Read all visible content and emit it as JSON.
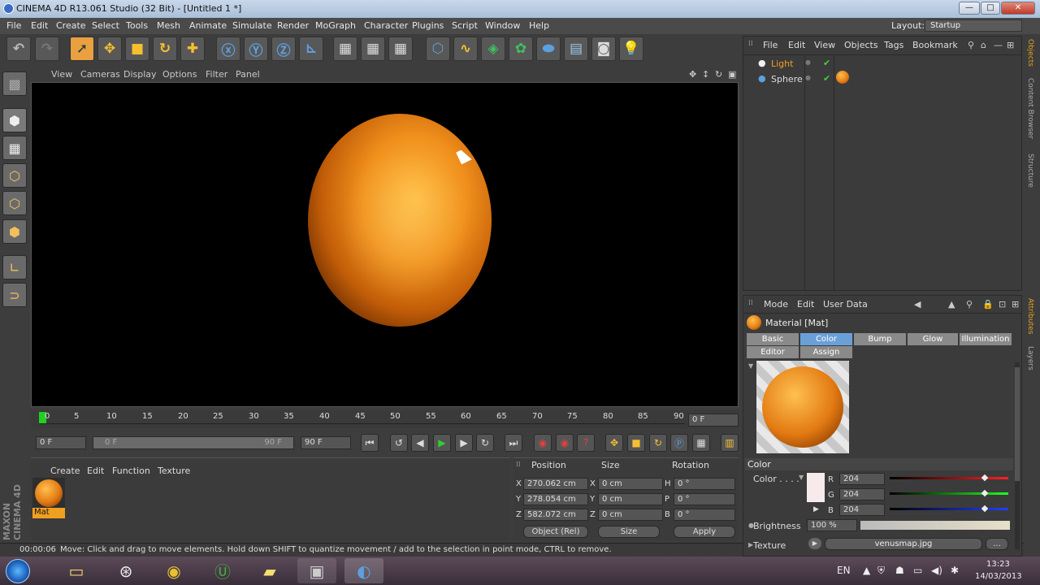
{
  "window": {
    "title": "CINEMA 4D R13.061 Studio (32 Bit) - [Untitled 1 *]",
    "min": "—",
    "max": "□",
    "close": "✕"
  },
  "menu": [
    "File",
    "Edit",
    "Create",
    "Select",
    "Tools",
    "Mesh",
    "Animate",
    "Simulate",
    "Render",
    "MoGraph",
    "Character",
    "Plugins",
    "Script",
    "Window",
    "Help"
  ],
  "layout": {
    "label": "Layout:",
    "value": "Startup"
  },
  "viewport_menu": [
    "View",
    "Cameras",
    "Display",
    "Options",
    "Filter",
    "Panel"
  ],
  "timeline": {
    "ticks": [
      "0",
      "5",
      "10",
      "15",
      "20",
      "25",
      "30",
      "35",
      "40",
      "45",
      "50",
      "55",
      "60",
      "65",
      "70",
      "75",
      "80",
      "85",
      "90"
    ],
    "current": "0 F"
  },
  "playback": {
    "start": "0 F",
    "range_start": "0 F",
    "range_end": "90 F",
    "end": "90 F"
  },
  "material_manager": {
    "menu": [
      "Create",
      "Edit",
      "Function",
      "Texture"
    ],
    "material_name": "Mat"
  },
  "coords": {
    "headers": {
      "position": "Position",
      "size": "Size",
      "rotation": "Rotation"
    },
    "rows": [
      {
        "axis": "X",
        "pos": "270.062 cm",
        "size_axis": "X",
        "size": "0 cm",
        "rot_axis": "H",
        "rot": "0 °"
      },
      {
        "axis": "Y",
        "pos": "278.054 cm",
        "size_axis": "Y",
        "size": "0 cm",
        "rot_axis": "P",
        "rot": "0 °"
      },
      {
        "axis": "Z",
        "pos": "582.072 cm",
        "size_axis": "Z",
        "size": "0 cm",
        "rot_axis": "B",
        "rot": "0 °"
      }
    ],
    "mode": "Object (Rel)",
    "size_mode": "Size",
    "apply": "Apply"
  },
  "status": {
    "time": "00:00:06",
    "message": "Move: Click and drag to move elements. Hold down SHIFT to quantize movement / add to the selection in point mode, CTRL to remove."
  },
  "objects_panel": {
    "menu": [
      "File",
      "Edit",
      "View",
      "Objects",
      "Tags",
      "Bookmark"
    ],
    "objects": [
      "Light",
      "Sphere"
    ]
  },
  "attributes": {
    "menu": [
      "Mode",
      "Edit",
      "User Data"
    ],
    "title": "Material [Mat]",
    "tabs": [
      "Basic",
      "Color",
      "Bump",
      "Glow",
      "Illumination"
    ],
    "tabs2": [
      "Editor",
      "Assign"
    ],
    "section": "Color",
    "color_label": "Color . . . .",
    "r_label": "R",
    "g_label": "G",
    "b_label": "B",
    "r": "204",
    "g": "204",
    "b": "204",
    "brightness_label": "Brightness",
    "brightness": "100 %",
    "texture_label": "Texture",
    "texture": "venusmap.jpg",
    "texture_more": "...",
    "rgb_fraction": 0.8
  },
  "side_tabs": [
    "Objects",
    "Content Browser",
    "Structure",
    "Attributes",
    "Layers"
  ],
  "branding": "MAXON CINEMA 4D",
  "taskbar": {
    "lang": "EN",
    "time": "13:23",
    "date": "14/03/2013"
  },
  "colors": {
    "accent": "#6aa0d8",
    "orange": "#f0a020",
    "viewport": "#000000"
  }
}
